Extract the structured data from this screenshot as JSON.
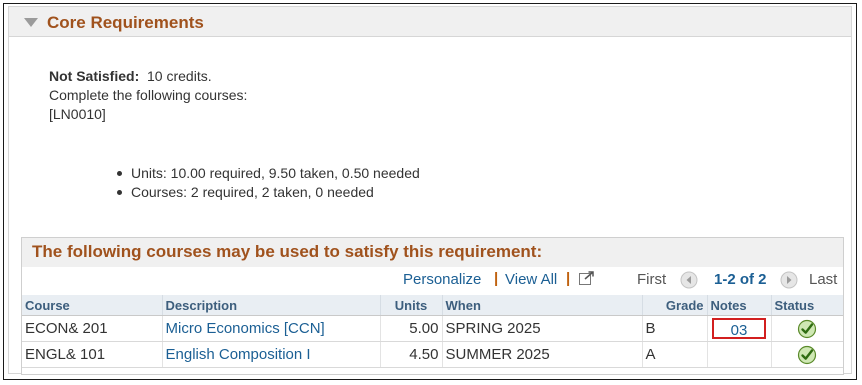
{
  "section": {
    "title": "Core Requirements",
    "status_label": "Not Satisfied:",
    "status_value": "10 credits.",
    "instruction": "Complete the following courses:",
    "course_code": "[LN0010]",
    "units_line": "Units: 10.00 required, 9.50 taken, 0.50 needed",
    "courses_line": "Courses: 2 required, 2 taken, 0 needed"
  },
  "grid": {
    "title": "The following courses may be used to satisfy this requirement:",
    "nav": {
      "personalize": "Personalize",
      "sep": "|",
      "view_all": "View All",
      "first": "First",
      "range": "1-2 of 2",
      "last": "Last"
    },
    "headers": [
      "Course",
      "Description",
      "Units",
      "When",
      "Grade",
      "Notes",
      "Status"
    ],
    "rows": [
      {
        "course": "ECON& 201",
        "description": "Micro Economics [CCN]",
        "units": "5.00",
        "when": "SPRING 2025",
        "grade": "B",
        "notes": "03",
        "status": "check-icon"
      },
      {
        "course": "ENGL& 101",
        "description": "English Composition I",
        "units": "4.50",
        "when": "SUMMER 2025",
        "grade": "A",
        "notes": "",
        "status": "check-icon"
      }
    ]
  },
  "colors": {
    "header_orange": "#a0521d",
    "link_blue": "#1b5f94",
    "check_green": "#4a9a1f",
    "highlight_red": "#d21f1f"
  }
}
